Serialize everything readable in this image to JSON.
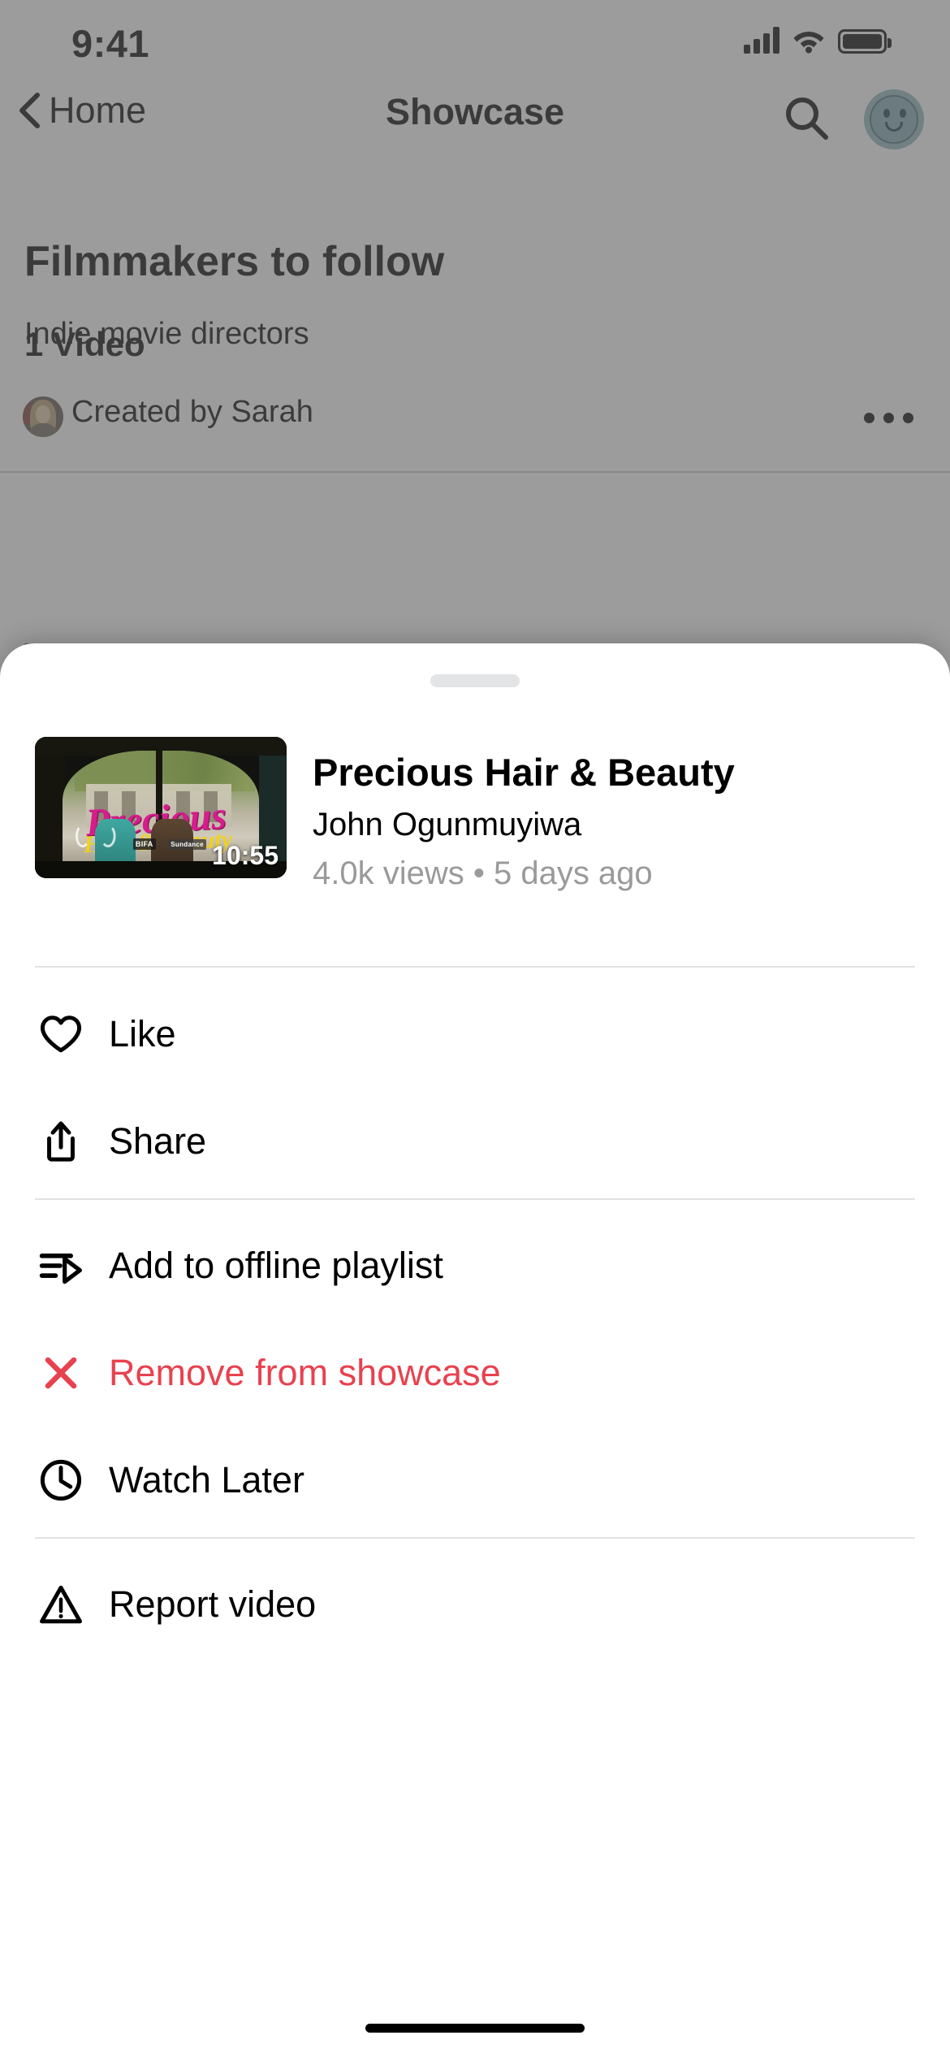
{
  "status_bar": {
    "time": "9:41",
    "icons": [
      "cellular-signal-icon",
      "wifi-icon",
      "battery-icon"
    ]
  },
  "nav_bar": {
    "back_label": "Home",
    "back_icon": "chevron-left-icon",
    "title": "Showcase",
    "search_icon": "search-icon",
    "avatar_icon": "account-avatar-icon"
  },
  "playlist": {
    "title": "Filmmakers to follow",
    "subtitle": "Indie movie directors",
    "creator_label": "Created by Sarah",
    "creator_avatar": "user-avatar-icon",
    "overflow_icon": "more-horizontal-icon",
    "video_count_label": "1 Video"
  },
  "background_video": {
    "title": "Precious Hair & Beauty",
    "channel": "John Ogunmuyiwa",
    "meta": "4.0k views • 5 days ago",
    "duration": "10:55",
    "overflow_icon": "more-horizontal-icon",
    "thumbnail": {
      "logo_primary": "Precious",
      "logo_secondary": "Hair & Beauty",
      "festival_badges": [
        "BIFA",
        "Sundance"
      ]
    }
  },
  "sheet": {
    "grab_handle": "drag-handle",
    "video": {
      "title": "Precious Hair & Beauty",
      "channel": "John Ogunmuyiwa",
      "meta": "4.0k views • 5 days ago",
      "duration": "10:55"
    },
    "menu_items": [
      {
        "label": "Like",
        "icon": "heart-icon",
        "danger": false
      },
      {
        "label": "Share",
        "icon": "share-icon",
        "danger": false
      },
      {
        "label": "Add to offline playlist",
        "icon": "playlist-add-icon",
        "danger": false
      },
      {
        "label": "Remove from showcase",
        "icon": "close-x-icon",
        "danger": true
      },
      {
        "label": "Watch Later",
        "icon": "clock-icon",
        "danger": false
      },
      {
        "label": "Report video",
        "icon": "warning-triangle-icon",
        "danger": false
      }
    ]
  },
  "colors": {
    "danger": "#e8424f",
    "avatar_teal": "#8fb6bd",
    "logo_magenta": "#d61d8c",
    "logo_gold": "#f0d021",
    "dim_overlay": "rgba(96,96,96,0.62)"
  },
  "home_indicator": "home-indicator"
}
